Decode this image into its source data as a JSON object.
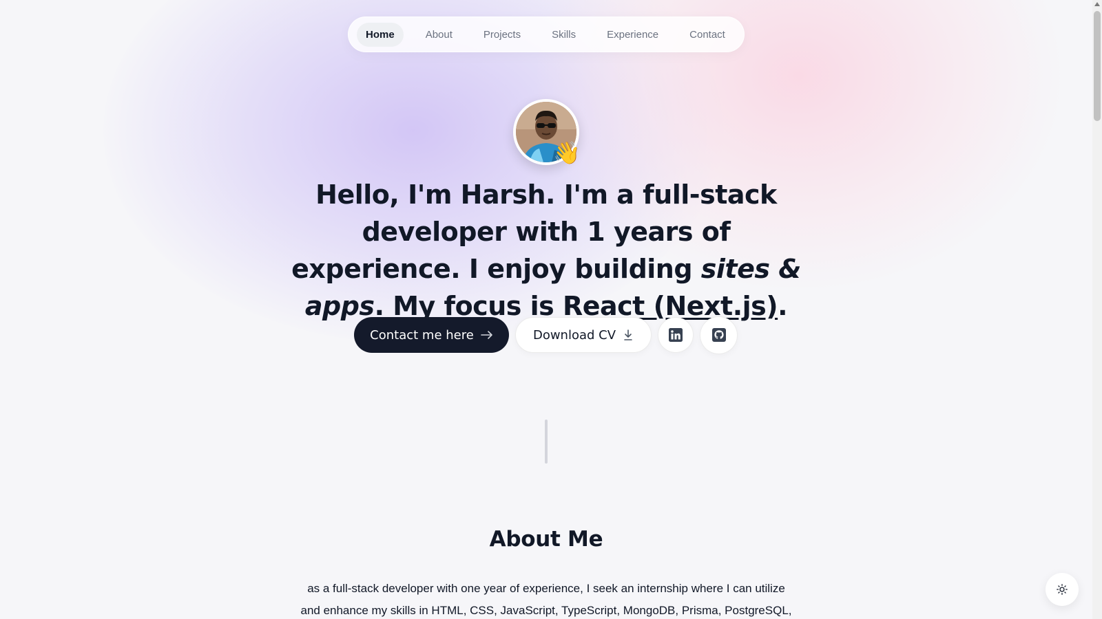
{
  "nav": {
    "items": [
      {
        "label": "Home",
        "active": true
      },
      {
        "label": "About",
        "active": false
      },
      {
        "label": "Projects",
        "active": false
      },
      {
        "label": "Skills",
        "active": false
      },
      {
        "label": "Experience",
        "active": false
      },
      {
        "label": "Contact",
        "active": false
      }
    ]
  },
  "hero": {
    "greeting": "Hello, I'm Harsh.",
    "t1": " I'm a ",
    "role": "full-stack developer",
    "t2": " with ",
    "years": "1 years",
    "t3": " of experience. I enjoy building ",
    "things": "sites & apps",
    "t4": ". My focus is ",
    "focus": "React (Next.js)",
    "t5": "."
  },
  "avatar": {
    "emoji": "👋"
  },
  "buttons": {
    "contact": "Contact me here",
    "download": "Download CV"
  },
  "about": {
    "title": "About Me",
    "text": "as a full-stack developer with one year of experience, I seek an internship where I can utilize and enhance my skills in HTML, CSS, JavaScript, TypeScript, MongoDB, Prisma, PostgreSQL,"
  },
  "icons": {
    "arrow": "arrow-right-icon",
    "download": "download-icon",
    "linkedin": "linkedin-icon",
    "github": "github-icon",
    "theme": "sun-icon"
  },
  "colors": {
    "primary_button": "#141a2b",
    "text": "#111827",
    "muted_nav": "#6b7280"
  }
}
